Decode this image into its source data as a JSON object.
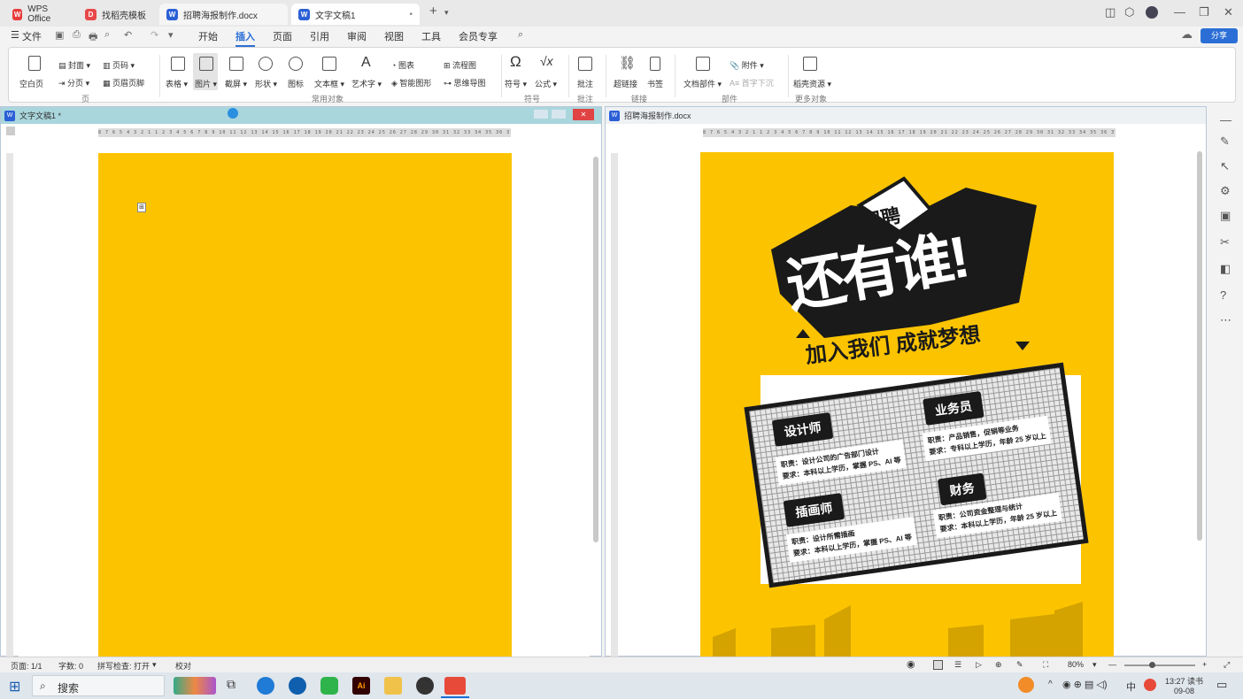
{
  "tabs": [
    {
      "label": "WPS Office",
      "icon": "wps-logo-icon",
      "color": "#e83b3b"
    },
    {
      "label": "找稻壳模板",
      "icon": "docer-icon",
      "color": "#e84848"
    },
    {
      "label": "招聘海报制作.docx",
      "icon": "word-doc-icon",
      "color": "#2b5fd6"
    },
    {
      "label": "文字文稿1",
      "icon": "word-doc-icon",
      "color": "#2b5fd6"
    }
  ],
  "menu": {
    "file": "文件",
    "items": [
      "开始",
      "插入",
      "页面",
      "引用",
      "审阅",
      "视图",
      "工具",
      "会员专享"
    ],
    "active": "插入",
    "share": "分享"
  },
  "ribbon": {
    "row1": [
      "封面",
      "页码",
      "表格",
      "图片",
      "截屏",
      "形状",
      "图标",
      "文本框",
      "艺术字",
      "图表",
      "流程图",
      "符号",
      "公式",
      "批注",
      "超链接",
      "书签",
      "文档部件",
      "附件",
      "稻壳资源"
    ],
    "blank_page": "空白页",
    "section": "分页",
    "header_footer": "页眉页脚",
    "smart_graphic": "智能图形",
    "mind_map": "思维导图",
    "drop_cap": "首字下沉",
    "groups": [
      "页",
      "常用对象",
      "符号",
      "批注",
      "链接",
      "部件",
      "更多对象"
    ]
  },
  "left_doc": {
    "title": "文字文稿1 *",
    "page_color": "#fcc400"
  },
  "right_doc": {
    "title": "招聘海报制作.docx"
  },
  "ruler_text": "8 7 6 5 4 3 2 1 1 2 3 4 5 6 7 8 9 10 11 12 13 14 15 16 17 18 19 20 21 22 23 24 25 26 27 28 29 30 31 32 33 34 35 36 37 38 39 40 41 42 43 44 45 46 47",
  "poster": {
    "badge": "招聘",
    "headline": "还有谁!",
    "subline": "加入我们 成就梦想",
    "jobs": [
      {
        "title": "设计师",
        "desc1": "职责：设计公司的广告部门设计",
        "desc2": "要求：本科以上学历，掌握 PS、AI 等"
      },
      {
        "title": "业务员",
        "desc1": "职责：产品销售，促销等业务",
        "desc2": "要求：专科以上学历，年龄 25 岁以上"
      },
      {
        "title": "插画师",
        "desc1": "职责：设计所需插画",
        "desc2": "要求：本科以上学历，掌握 PS、AI 等"
      },
      {
        "title": "财务",
        "desc1": "职责：公司资金整理与统计",
        "desc2": "要求：本科以上学历，年龄 25 岁以上"
      }
    ]
  },
  "status": {
    "page": "页面: 1/1",
    "words": "字数: 0",
    "spell": "拼写检查: 打开",
    "proof": "校对",
    "zoom": "80%"
  },
  "taskbar": {
    "search": "搜索",
    "time": "13:27 读书",
    "date": "09-08",
    "ime": "中"
  }
}
